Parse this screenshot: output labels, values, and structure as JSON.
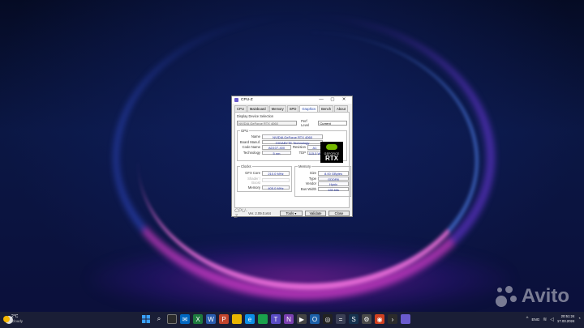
{
  "window": {
    "title": "CPU-Z",
    "controls": {
      "minimize": "—",
      "maximize": "▢",
      "close": "✕"
    },
    "tabs": [
      "CPU",
      "Mainboard",
      "Memory",
      "SPD",
      "Graphics",
      "Bench",
      "About"
    ],
    "active_tab": "Graphics"
  },
  "graphics": {
    "device_selection_label": "Display Device Selection",
    "device_selected": "NVIDIA GeForce RTX 4060",
    "perf_level_label": "Perf Level",
    "perf_level_value": "Current",
    "gpu_group": "GPU",
    "gpu_fields": {
      "name_label": "Name",
      "name_value": "NVIDIA GeForce RTX 4060",
      "board_label": "Board Manuf.",
      "board_value": "GIGABYTE Technology",
      "codename_label": "Code Name",
      "codename_value": "AD107-400",
      "revision_label": "Revision",
      "revision_value": "A1",
      "technology_label": "Technology",
      "technology_value": "5 nm",
      "tdp_label": "TDP",
      "tdp_value": "115.0 W"
    },
    "badge": {
      "line1": "GEFORCE",
      "line2": "RTX"
    },
    "clocks_group": "Clocks",
    "clocks": {
      "gfx_label": "GFX Core",
      "gfx_value": "210.0 MHz",
      "shader_label": "Shader / Boost",
      "shader_value": "",
      "memory_label": "Memory",
      "memory_value": "405.0 MHz"
    },
    "memory_group": "Memory",
    "memory": {
      "size_label": "Size",
      "size_value": "8.00 GBytes",
      "type_label": "Type",
      "type_value": "GDDR6",
      "vendor_label": "Vendor",
      "vendor_value": "Hynix",
      "bus_label": "Bus Width",
      "bus_value": "128 bits"
    }
  },
  "footer": {
    "brand": "CPU-Z",
    "version": "Ver. 2.09.0.x64",
    "tools_label": "Tools",
    "validate_label": "Validate",
    "close_label": "Close"
  },
  "taskbar": {
    "weather_temp": "2°C",
    "weather_desc": "Cloudy",
    "language": "ENG",
    "time": "20:51:24",
    "date": "17.03.2024"
  },
  "watermark": "Avito",
  "colors": {
    "accent": "#1d3fa6",
    "nvidia_green": "#76b900",
    "taskbar": "#1c2036"
  }
}
